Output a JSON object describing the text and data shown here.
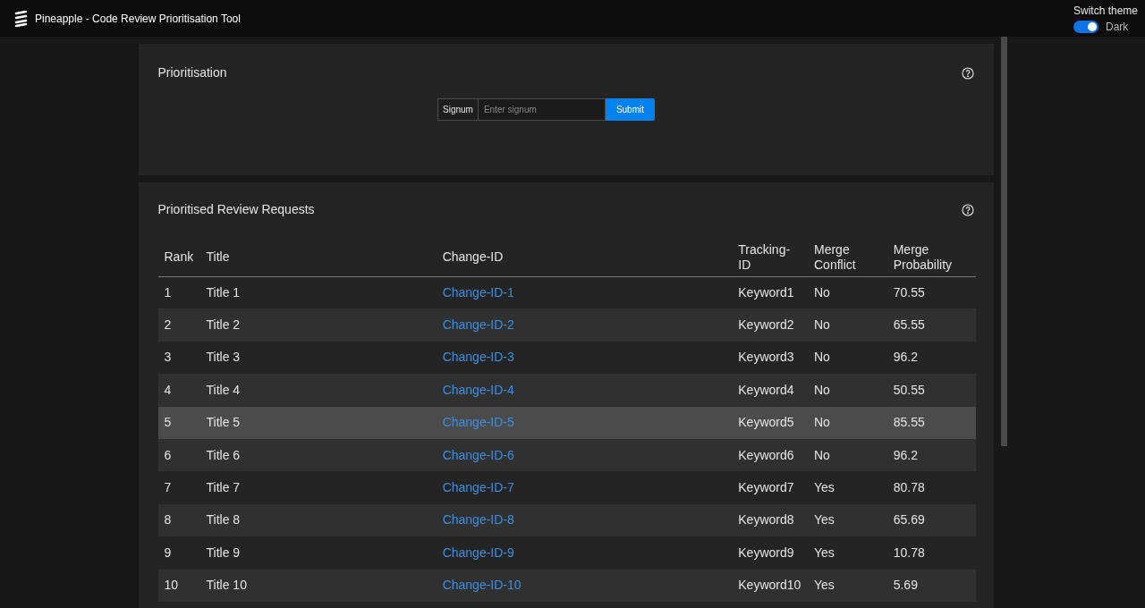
{
  "header": {
    "title": "Pineapple - Code Review Prioritisation Tool",
    "theme_label": "Switch theme",
    "theme_switch": {
      "on": true,
      "label": "Dark"
    }
  },
  "prioritisation": {
    "title": "Prioritisation",
    "field_label": "Signum",
    "placeholder": "Enter signum",
    "button": "Submit"
  },
  "requests": {
    "title": "Prioritised Review Requests",
    "columns": [
      "Rank",
      "Title",
      "Change-ID",
      "Tracking-ID",
      "Merge Conflict",
      "Merge Probability"
    ],
    "rows": [
      {
        "rank": "1",
        "title": "Title 1",
        "change_id": "Change-ID-1",
        "tracking_id": "Keyword1",
        "merge_conflict": "No",
        "merge_probability": "70.55",
        "selected": false
      },
      {
        "rank": "2",
        "title": "Title 2",
        "change_id": "Change-ID-2",
        "tracking_id": "Keyword2",
        "merge_conflict": "No",
        "merge_probability": "65.55",
        "selected": false
      },
      {
        "rank": "3",
        "title": "Title 3",
        "change_id": "Change-ID-3",
        "tracking_id": "Keyword3",
        "merge_conflict": "No",
        "merge_probability": "96.2",
        "selected": false
      },
      {
        "rank": "4",
        "title": "Title 4",
        "change_id": "Change-ID-4",
        "tracking_id": "Keyword4",
        "merge_conflict": "No",
        "merge_probability": "50.55",
        "selected": false
      },
      {
        "rank": "5",
        "title": "Title 5",
        "change_id": "Change-ID-5",
        "tracking_id": "Keyword5",
        "merge_conflict": "No",
        "merge_probability": "85.55",
        "selected": true
      },
      {
        "rank": "6",
        "title": "Title 6",
        "change_id": "Change-ID-6",
        "tracking_id": "Keyword6",
        "merge_conflict": "No",
        "merge_probability": "96.2",
        "selected": false
      },
      {
        "rank": "7",
        "title": "Title 7",
        "change_id": "Change-ID-7",
        "tracking_id": "Keyword7",
        "merge_conflict": "Yes",
        "merge_probability": "80.78",
        "selected": false
      },
      {
        "rank": "8",
        "title": "Title 8",
        "change_id": "Change-ID-8",
        "tracking_id": "Keyword8",
        "merge_conflict": "Yes",
        "merge_probability": "65.69",
        "selected": false
      },
      {
        "rank": "9",
        "title": "Title 9",
        "change_id": "Change-ID-9",
        "tracking_id": "Keyword9",
        "merge_conflict": "Yes",
        "merge_probability": "10.78",
        "selected": false
      },
      {
        "rank": "10",
        "title": "Title 10",
        "change_id": "Change-ID-10",
        "tracking_id": "Keyword10",
        "merge_conflict": "Yes",
        "merge_probability": "5.69",
        "selected": false
      }
    ]
  }
}
